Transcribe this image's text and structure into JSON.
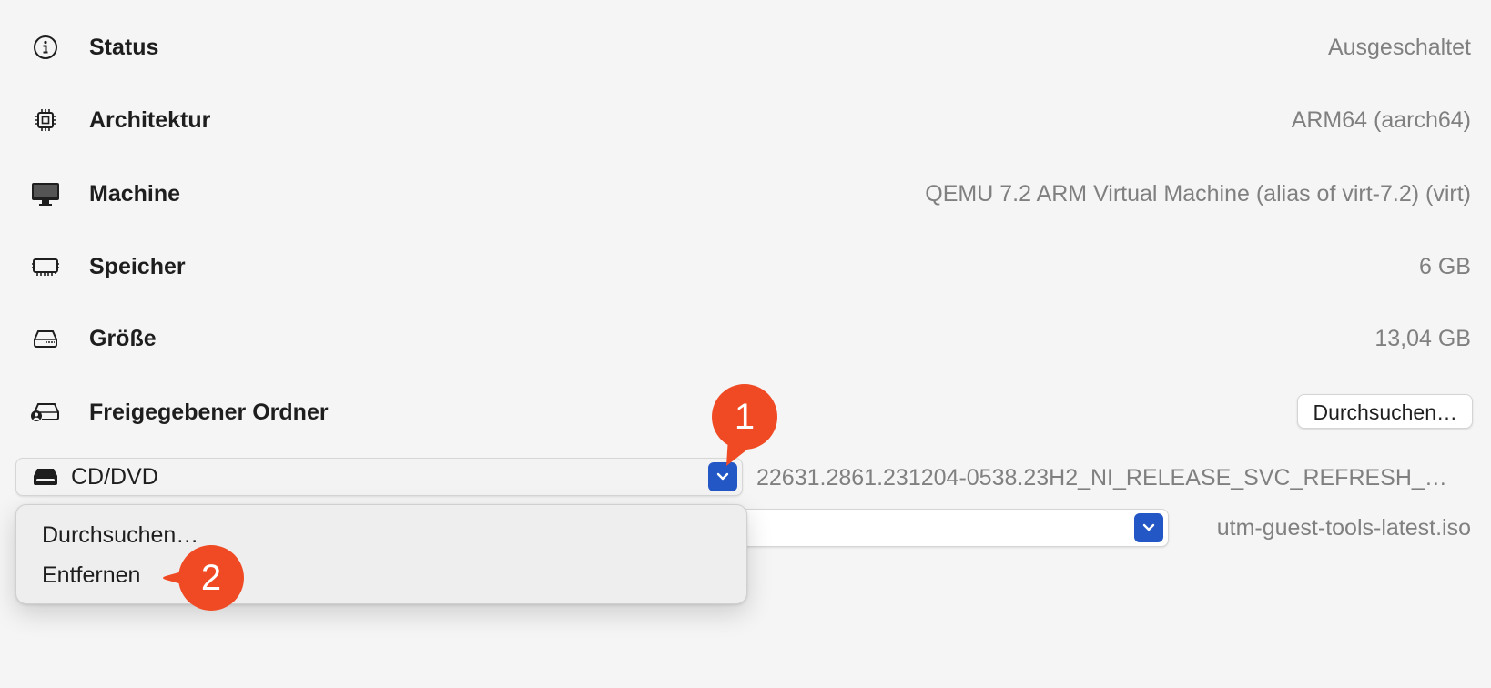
{
  "info_rows": [
    {
      "label": "Status",
      "value": "Ausgeschaltet",
      "icon": "info-icon"
    },
    {
      "label": "Architektur",
      "value": "ARM64 (aarch64)",
      "icon": "cpu-icon"
    },
    {
      "label": "Machine",
      "value": "QEMU 7.2 ARM Virtual Machine (alias of virt-7.2) (virt)",
      "icon": "monitor-icon"
    },
    {
      "label": "Speicher",
      "value": "6 GB",
      "icon": "memory-icon"
    },
    {
      "label": "Größe",
      "value": "13,04 GB",
      "icon": "drive-icon"
    }
  ],
  "shared_folder": {
    "label": "Freigegebener Ordner",
    "button_label": "Durchsuchen…",
    "icon": "shared-drive-icon"
  },
  "drives": [
    {
      "label": "CD/DVD",
      "value": "22631.2861.231204-0538.23H2_NI_RELEASE_SVC_REFRESH_…",
      "icon": "optical-drive-icon"
    },
    {
      "label": "",
      "value": "utm-guest-tools-latest.iso"
    }
  ],
  "dropdown_menu": {
    "items": [
      "Durchsuchen…",
      "Entfernen"
    ]
  },
  "callouts": [
    "1",
    "2"
  ],
  "colors": {
    "accent": "#2357c5",
    "callout": "#f04a24",
    "background": "#f5f5f5",
    "muted_text": "#808080"
  }
}
